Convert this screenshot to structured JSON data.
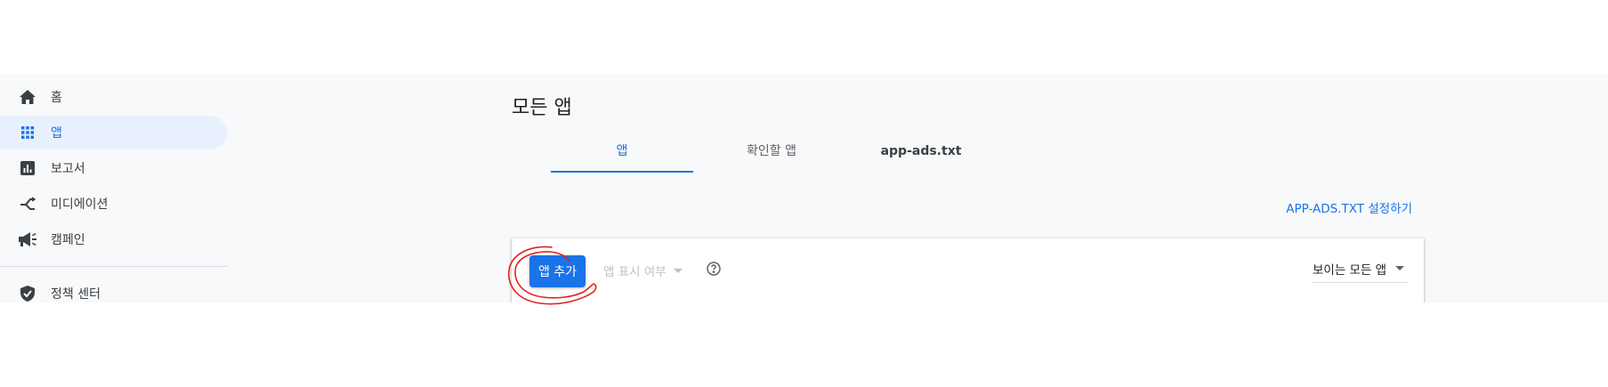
{
  "sidebar": {
    "items": [
      {
        "label": "홈",
        "icon": "home-icon"
      },
      {
        "label": "앱",
        "icon": "apps-grid-icon",
        "active": true
      },
      {
        "label": "보고서",
        "icon": "report-icon"
      },
      {
        "label": "미디에이션",
        "icon": "mediation-icon"
      },
      {
        "label": "캠페인",
        "icon": "campaign-icon"
      },
      {
        "label": "정책 센터",
        "icon": "policy-shield-icon"
      }
    ]
  },
  "main": {
    "title": "모든 앱",
    "tabs": [
      {
        "label": "앱",
        "active": true
      },
      {
        "label": "확인할 앱"
      },
      {
        "label": "app-ads.txt"
      }
    ],
    "setup_link": "APP-ADS.TXT 설정하기",
    "toolbar": {
      "add_button": "앱 추가",
      "visibility_filter": "앱 표시 여부",
      "view_select": "보이는 모든 앱"
    }
  },
  "colors": {
    "accent": "#1a73e8",
    "active_bg": "#e8f0fe",
    "annotation": "#e0241c"
  }
}
